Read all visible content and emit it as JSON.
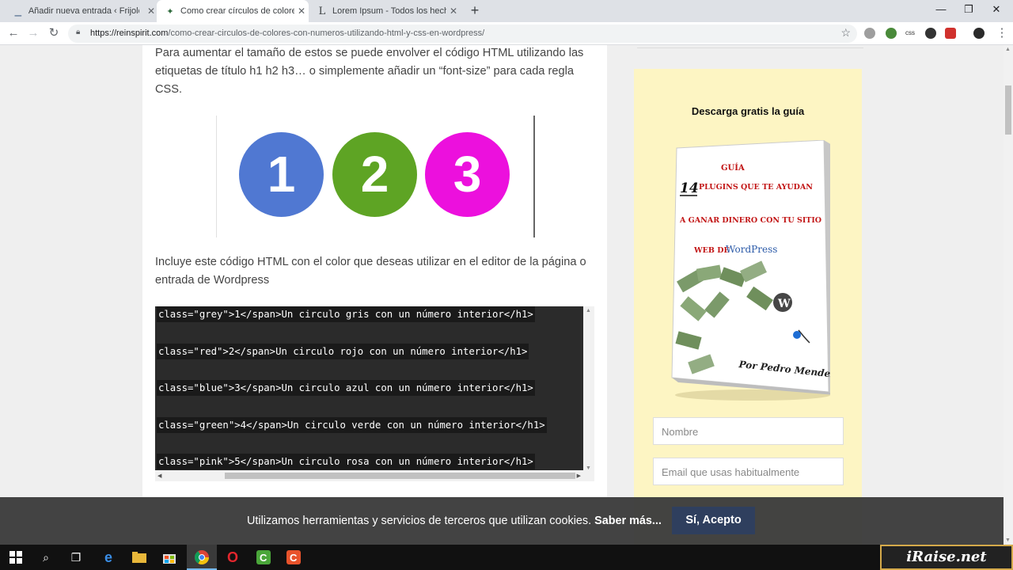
{
  "browser": {
    "tabs": [
      {
        "title": "Añadir nueva entrada ‹ Frijoleros"
      },
      {
        "title": "Como crear círculos de colores c"
      },
      {
        "title": "Lorem Ipsum - Todos los hechos"
      }
    ],
    "url_host": "https://reinspirit.com",
    "url_path": "/como-crear-circulos-de-colores-con-numeros-utilizando-html-y-css-en-wordpress/",
    "ext_css_label": "css"
  },
  "article": {
    "para1": "Para aumentar el tamaño de estos se puede envolver el código HTML utilizando las etiquetas de título h1 h2 h3… o simplemente añadir un “font-size” para cada regla CSS.",
    "circles": [
      {
        "label": "1",
        "color": "#5078d2"
      },
      {
        "label": "2",
        "color": "#5ea424"
      },
      {
        "label": "3",
        "color": "#ec10dd"
      }
    ],
    "para2": "Incluye este código HTML con el color que deseas utilizar en el editor de la página o entrada de Wordpress",
    "code_lines": [
      "class=\"grey\">1</span>Un circulo gris con un número interior</h1>",
      "class=\"red\">2</span>Un circulo rojo con un número interior</h1>",
      "class=\"blue\">3</span>Un circulo azul con un número interior</h1>",
      "class=\"green\">4</span>Un circulo verde con un número interior</h1>",
      "class=\"pink\">5</span>Un circulo rosa con un número interior</h1>"
    ]
  },
  "sidebar": {
    "title": "Descarga gratis la guía",
    "book": {
      "line1": "GUÍA",
      "number": "14",
      "line2": "PLUGINS QUE TE AYUDAN",
      "line3": "A GANAR DINERO CON TU SITIO",
      "line4_prefix": "WEB DE",
      "line4_brand": "WordPress",
      "author": "Por Pedro Mendez"
    },
    "name_placeholder": "Nombre",
    "email_placeholder": "Email que usas habitualmente"
  },
  "cookie": {
    "text": "Utilizamos herramientas y servicios de terceros que utilizan cookies.",
    "more": "Saber más...",
    "accept": "Sí, Acepto"
  },
  "watermark": "iRaise.net"
}
